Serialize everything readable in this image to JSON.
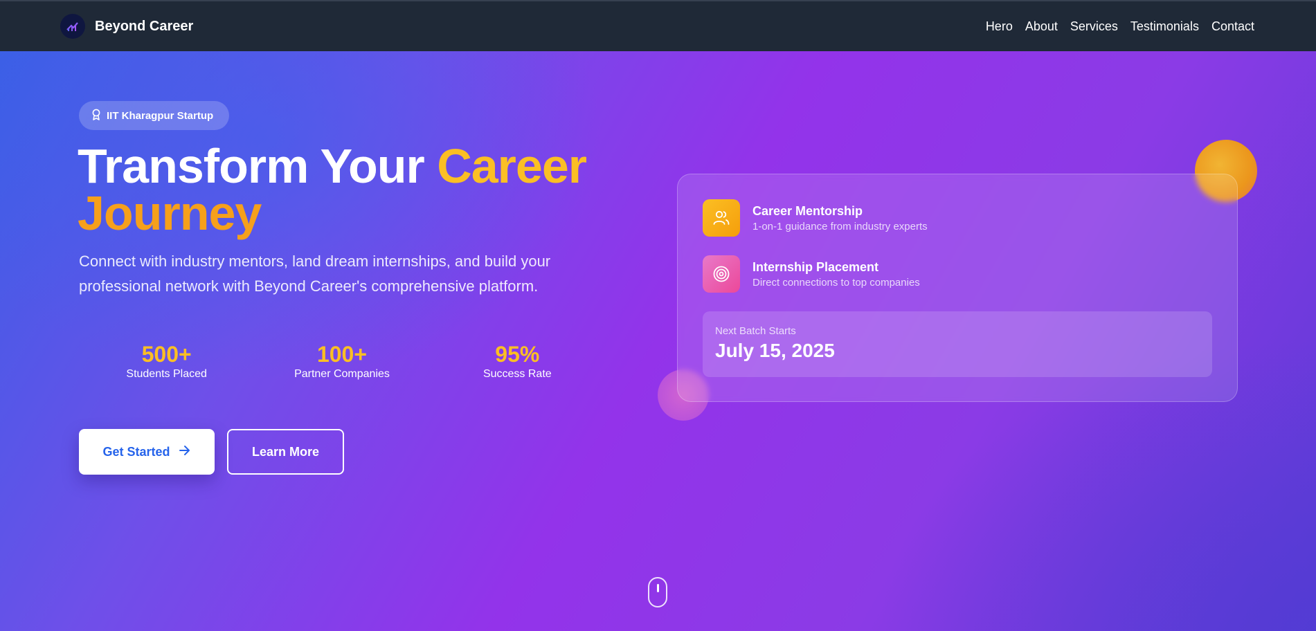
{
  "nav": {
    "brand": "Beyond Career",
    "links": [
      "Hero",
      "About",
      "Services",
      "Testimonials",
      "Contact"
    ]
  },
  "hero": {
    "badge": "IIT Kharagpur Startup",
    "headline_part1": "Transform Your ",
    "headline_part2": "Career",
    "headline_part3": "Journey",
    "subtext": "Connect with industry mentors, land dream internships, and build your professional network with Beyond Career's comprehensive platform.",
    "stats": [
      {
        "value": "500+",
        "label": "Students Placed"
      },
      {
        "value": "100+",
        "label": "Partner Companies"
      },
      {
        "value": "95%",
        "label": "Success Rate"
      }
    ],
    "primary_button": "Get Started",
    "secondary_button": "Learn More"
  },
  "card": {
    "features": [
      {
        "title": "Career Mentorship",
        "description": "1-on-1 guidance from industry experts",
        "icon": "users-icon"
      },
      {
        "title": "Internship Placement",
        "description": "Direct connections to top companies",
        "icon": "target-icon"
      }
    ],
    "batch_label": "Next Batch Starts",
    "batch_date": "July 15, 2025"
  },
  "colors": {
    "accent_yellow": "#fbbf24",
    "primary_blue": "#2563eb",
    "nav_bg": "#1f2937",
    "gradient_purple": "#9333ea"
  }
}
